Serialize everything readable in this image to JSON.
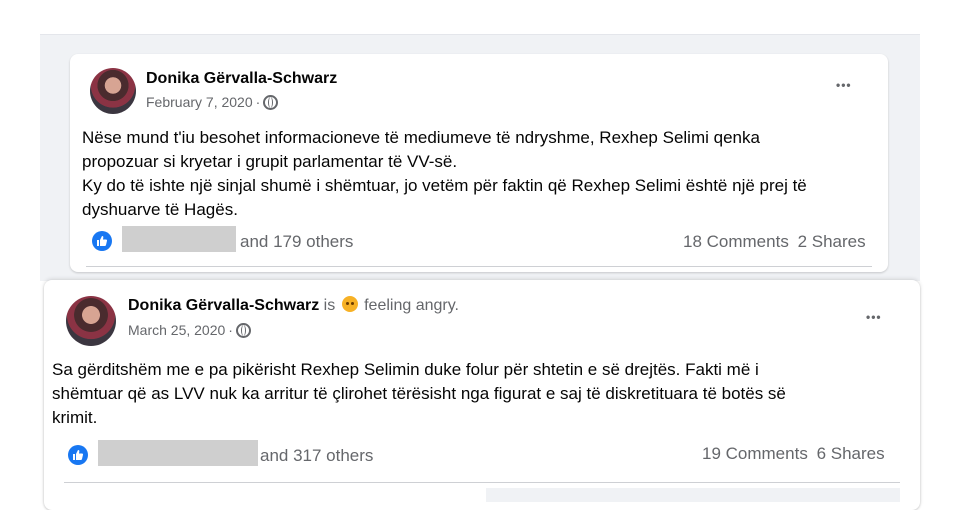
{
  "posts": [
    {
      "author": "Donika Gërvalla-Schwarz",
      "date": "February 7, 2020",
      "separator": "·",
      "more": "•••",
      "text": [
        "Nëse mund t'iu besohet informacioneve të mediumeve të ndryshme, Rexhep Selimi qenka",
        "propozuar si kryetar i grupit parlamentar të VV-së.",
        "Ky do të ishte një sinjal shumë i shëmtuar, jo vetëm për faktin që Rexhep Selimi është një prej të",
        "dyshuarve të Hagës."
      ],
      "reactions_others": "and 179 others",
      "comments": "18 Comments",
      "shares": "2 Shares"
    },
    {
      "author": "Donika Gërvalla-Schwarz",
      "status_is": "is",
      "status_feeling": "feeling angry.",
      "date": "March 25, 2020",
      "separator": "·",
      "more": "•••",
      "text": [
        "Sa gërditshëm me e pa pikërisht Rexhep Selimin duke folur për shtetin e së drejtës. Fakti më i",
        "shëmtuar që as LVV nuk ka arritur të çlirohet tërësisht nga figurat e saj të diskretituara të botës së",
        "krimit."
      ],
      "reactions_others": "and 317 others",
      "comments": "19 Comments",
      "shares": "6 Shares"
    }
  ],
  "colors": {
    "like_blue": "#1877f2",
    "secondary_text": "#65676b",
    "angry_emoji": "#f7b125"
  }
}
